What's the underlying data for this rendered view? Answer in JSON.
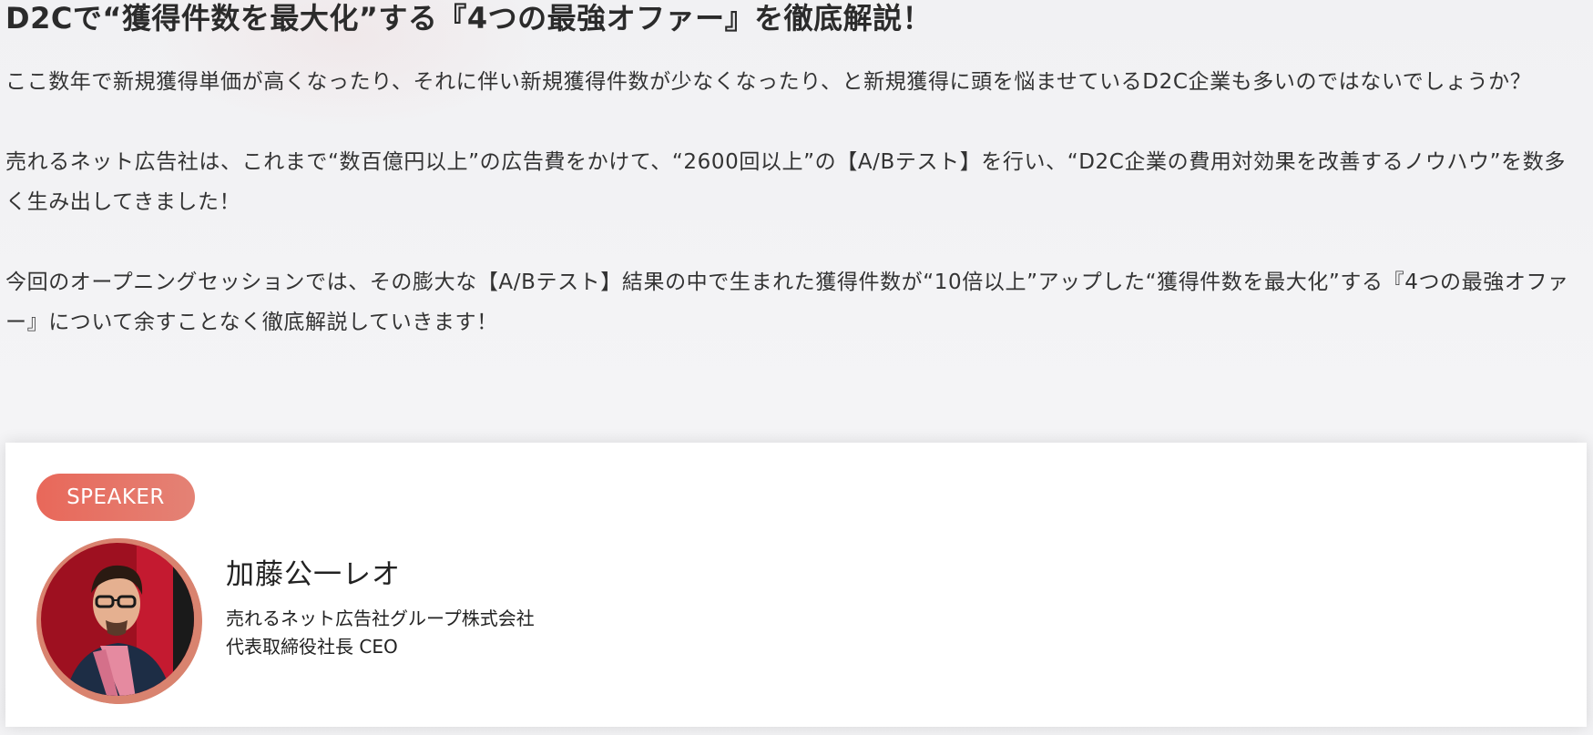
{
  "headline": "D2Cで“獲得件数を最大化”する『4つの最強オファー』を徹底解説！",
  "intro": {
    "paragraphs": [
      "ここ数年で新規獲得単価が高くなったり、それに伴い新規獲得件数が少なくなったり、と新規獲得に頭を悩ませているD2C企業も多いのではないでしょうか？",
      "売れるネット広告社は、これまで“数百億円以上”の広告費をかけて、“2600回以上”の【A/Bテスト】を行い、“D2C企業の費用対効果を改善するノウハウ”を数多く生み出してきました！",
      "今回のオープニングセッションでは、その膨大な【A/Bテスト】結果の中で生まれた獲得件数が“10倍以上”アップした“獲得件数を最大化”する『4つの最強オファー』について余すことなく徹底解説していきます！"
    ]
  },
  "speaker": {
    "badge": "SPEAKER",
    "name": "加藤公一レオ",
    "company": "売れるネット広告社グループ株式会社",
    "role": "代表取締役社長 CEO"
  },
  "colors": {
    "accent": "#e8685a",
    "background": "#f3f3f5",
    "card": "#ffffff",
    "text": "#333333"
  }
}
